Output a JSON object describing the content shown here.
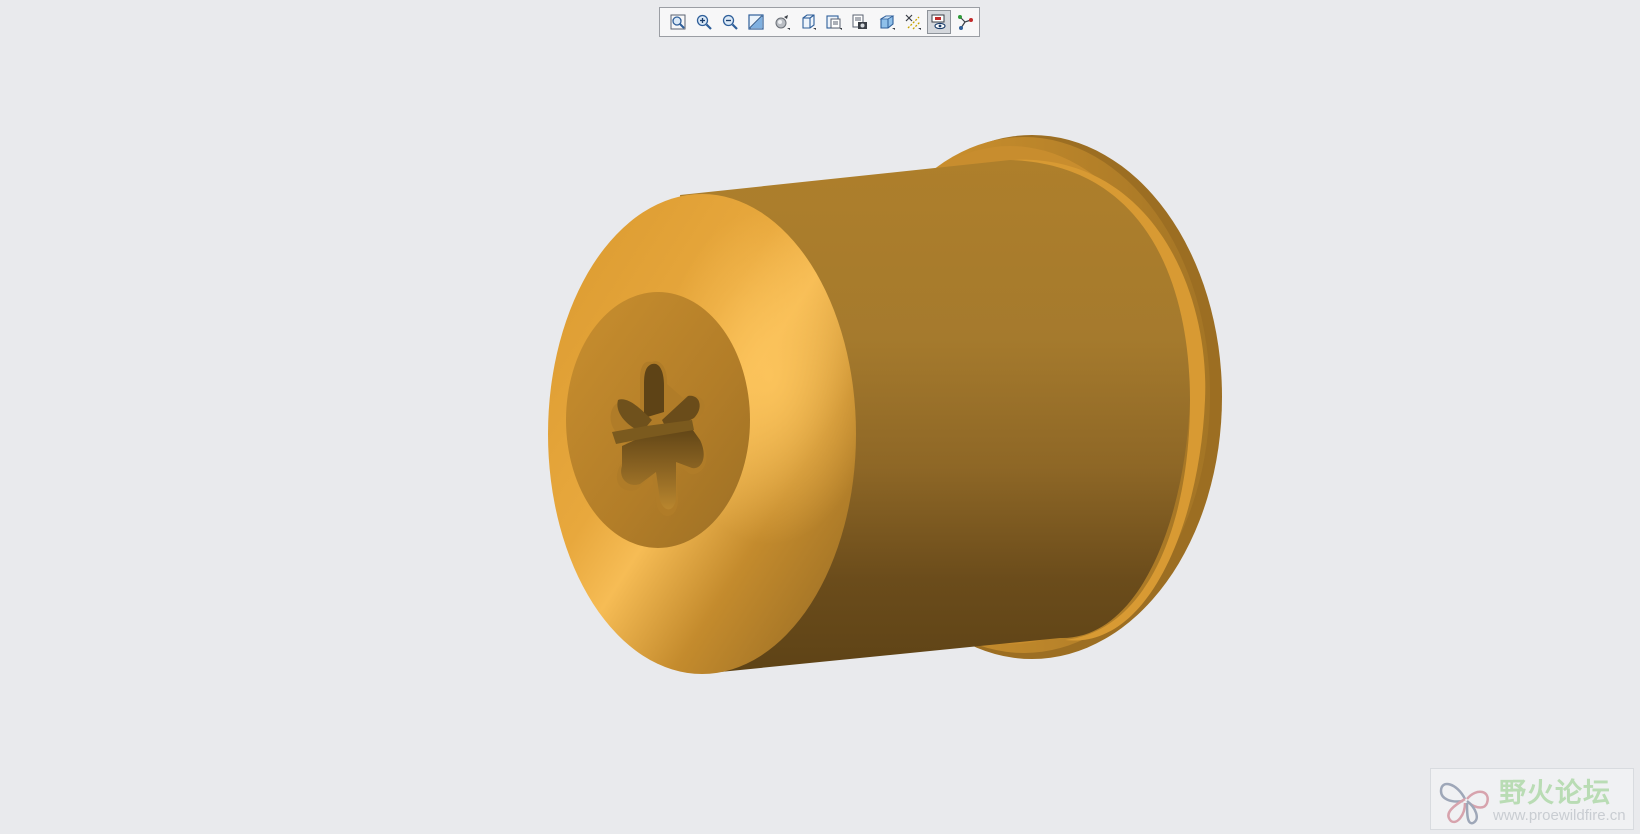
{
  "toolbar": {
    "buttons": [
      {
        "icon": "refit-icon",
        "active": false
      },
      {
        "icon": "zoom-in-icon",
        "active": false
      },
      {
        "icon": "zoom-out-icon",
        "active": false
      },
      {
        "icon": "repaint-icon",
        "active": false
      },
      {
        "icon": "spin-center-icon",
        "active": false
      },
      {
        "icon": "saved-orientations-icon",
        "active": false
      },
      {
        "icon": "view-manager-icon",
        "active": false
      },
      {
        "icon": "appearance-gallery-icon",
        "active": false
      },
      {
        "icon": "display-style-icon",
        "active": false
      },
      {
        "icon": "datum-display-icon",
        "active": false
      },
      {
        "icon": "annotation-display-icon",
        "active": true
      },
      {
        "icon": "sketch-view-icon",
        "active": false
      }
    ]
  },
  "model": {
    "name": "screw-bushing-part",
    "color": "#c48d30",
    "highlight": "#f5bb55",
    "shadow": "#684a1a"
  },
  "watermark": {
    "title": "野火论坛",
    "url": "www.proewildfire.cn"
  }
}
